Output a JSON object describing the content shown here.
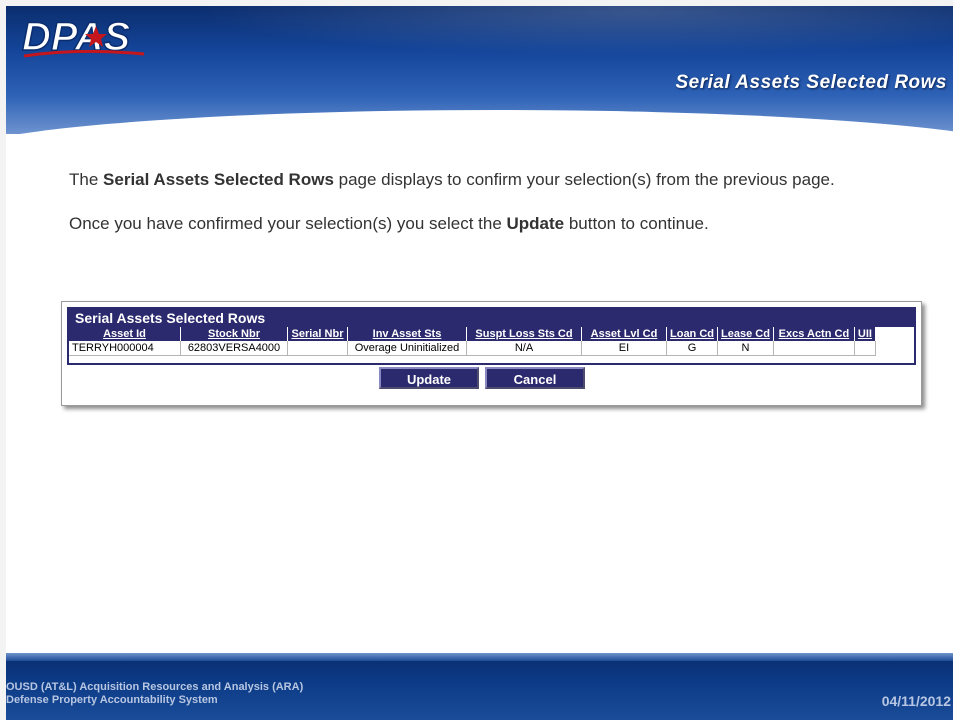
{
  "header": {
    "logo_text": "DPAS",
    "slide_title": "Serial Assets Selected Rows"
  },
  "body": {
    "para1_pre": "The ",
    "para1_bold": "Serial Assets Selected Rows",
    "para1_post": " page displays to confirm your selection(s) from the previous page.",
    "para2_pre": "Once you have confirmed your selection(s) you select the ",
    "para2_bold": "Update",
    "para2_post": " button to continue."
  },
  "grid": {
    "title": "Serial Assets Selected Rows",
    "columns": [
      "Asset Id",
      "Stock Nbr",
      "Serial Nbr",
      "Inv Asset Sts",
      "Suspt Loss Sts Cd",
      "Asset Lvl Cd",
      "Loan Cd",
      "Lease Cd",
      "Excs Actn Cd",
      "UII"
    ],
    "rows": [
      [
        "TERRYH000004",
        "62803VERSA4000",
        "",
        "Overage Uninitialized",
        "N/A",
        "EI",
        "G",
        "N",
        "",
        ""
      ]
    ]
  },
  "buttons": {
    "update": "Update",
    "cancel": "Cancel"
  },
  "footer": {
    "org_line1": "OUSD (AT&L) Acquisition Resources and Analysis (ARA)",
    "org_line2": "Defense Property Accountability System",
    "date": "04/11/2012"
  },
  "colors": {
    "header_blue": "#14459a",
    "grid_navy": "#2c2a6e",
    "logo_red": "#c4161c"
  }
}
